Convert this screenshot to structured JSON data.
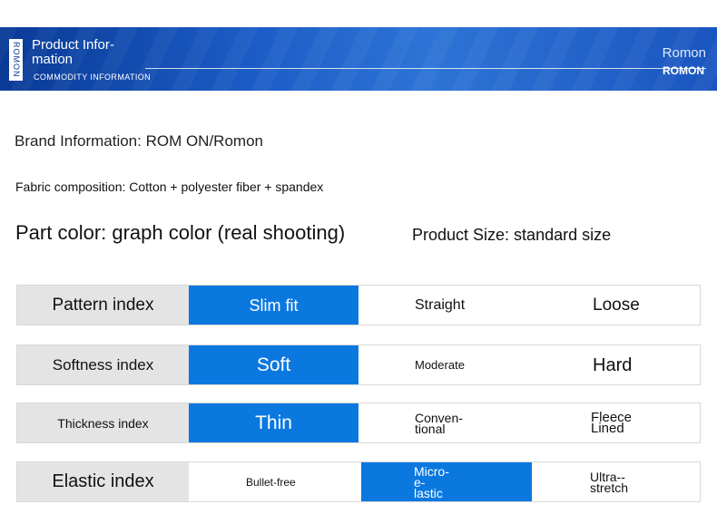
{
  "banner": {
    "side_tag": "ROMON",
    "title": "Product Infor-mation",
    "subtitle": "COMMODITY INFORMATION",
    "brand": "Romon",
    "brand_caps": "ROMON",
    "background_color": "#1b5cc6"
  },
  "info": {
    "brand": "Brand Information: ROM ON/Romon",
    "fabric": "Fabric composition: Cotton + polyester fiber + spandex",
    "color": "Part color: graph color (real shooting)",
    "size": "Product Size: standard size"
  },
  "highlight_color": "#0b78e0",
  "indices": [
    {
      "label": "Pattern index",
      "options": [
        "Slim fit",
        "Straight",
        "Loose"
      ],
      "selected": "Slim fit"
    },
    {
      "label": "Softness index",
      "options": [
        "Soft",
        "Moderate",
        "Hard"
      ],
      "selected": "Soft"
    },
    {
      "label": "Thickness index",
      "options": [
        "Thin",
        "Conven-tional",
        "Fleece Lined"
      ],
      "selected": "Thin"
    },
    {
      "label": "Elastic index",
      "options": [
        "Bullet-free",
        "Micro-e-lastic",
        "Ultra--stretch"
      ],
      "selected": "Micro-e-lastic"
    }
  ]
}
